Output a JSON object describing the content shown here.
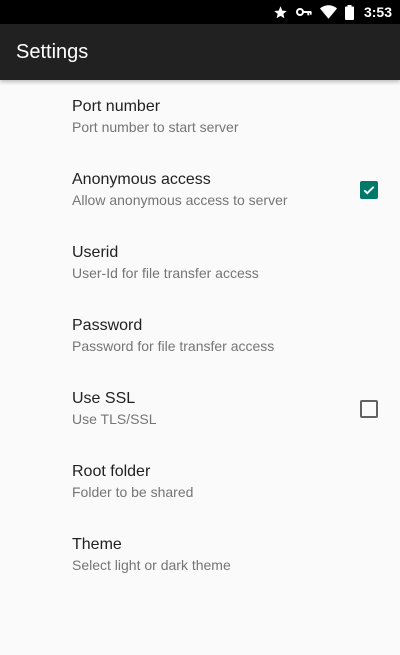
{
  "status_bar": {
    "time": "3:53",
    "icons": [
      "star-icon",
      "vpn-key-icon",
      "wifi-icon",
      "battery-icon"
    ]
  },
  "app_bar": {
    "title": "Settings"
  },
  "colors": {
    "app_bar_bg": "#212121",
    "accent": "#00796b",
    "background": "#fafafa"
  },
  "preferences": [
    {
      "title": "Port number",
      "summary": "Port number to start server"
    },
    {
      "title": "Anonymous access",
      "summary": "Allow anonymous access to server",
      "checked": true
    },
    {
      "title": "Userid",
      "summary": "User-Id for file transfer access"
    },
    {
      "title": "Password",
      "summary": "Password for file transfer access"
    },
    {
      "title": "Use SSL",
      "summary": "Use TLS/SSL",
      "checked": false
    },
    {
      "title": "Root folder",
      "summary": "Folder to be shared"
    },
    {
      "title": "Theme",
      "summary": "Select light or dark theme"
    }
  ]
}
